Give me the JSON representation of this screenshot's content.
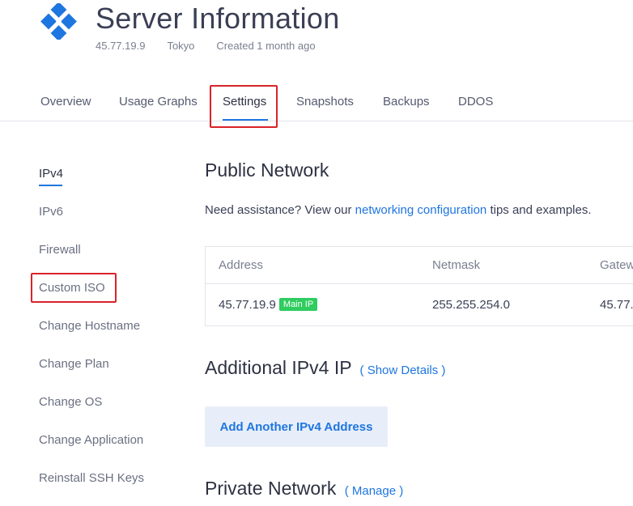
{
  "header": {
    "title": "Server Information",
    "ip": "45.77.19.9",
    "location": "Tokyo",
    "created": "Created 1 month ago",
    "logo_icon": "vultr-logo-icon",
    "brand_color": "#1e76e0"
  },
  "tabs": [
    {
      "label": "Overview"
    },
    {
      "label": "Usage Graphs"
    },
    {
      "label": "Settings",
      "active": true
    },
    {
      "label": "Snapshots"
    },
    {
      "label": "Backups"
    },
    {
      "label": "DDOS"
    }
  ],
  "sidebar": {
    "items": [
      {
        "label": "IPv4",
        "active": true
      },
      {
        "label": "IPv6"
      },
      {
        "label": "Firewall"
      },
      {
        "label": "Custom ISO"
      },
      {
        "label": "Change Hostname"
      },
      {
        "label": "Change Plan"
      },
      {
        "label": "Change OS"
      },
      {
        "label": "Change Application"
      },
      {
        "label": "Reinstall SSH Keys"
      }
    ]
  },
  "public_network": {
    "title": "Public Network",
    "assist_prefix": "Need assistance? View our ",
    "assist_link": "networking configuration",
    "assist_suffix": " tips and examples.",
    "table": {
      "headers": [
        "Address",
        "Netmask",
        "Gatew"
      ],
      "row": {
        "address": "45.77.19.9",
        "badge": "Main IP",
        "netmask": "255.255.254.0",
        "gateway": "45.77."
      }
    }
  },
  "additional_ipv4": {
    "title": "Additional IPv4 IP",
    "link": "( Show Details )",
    "button": "Add Another IPv4 Address"
  },
  "private_network": {
    "title": "Private Network",
    "link": "( Manage )"
  },
  "colors": {
    "accent": "#1e76e0",
    "highlight": "#d9232a",
    "badge": "#2fcc5f"
  }
}
